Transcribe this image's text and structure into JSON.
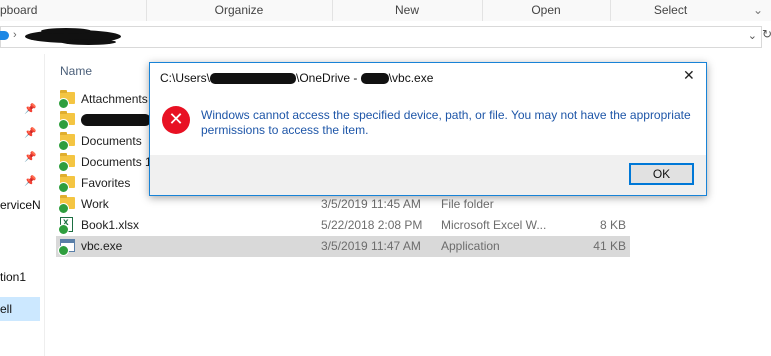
{
  "ribbon": {
    "groups": [
      "pboard",
      "Organize",
      "New",
      "Open",
      "Select"
    ]
  },
  "nav": {
    "items": [
      "erviceN",
      "tion1",
      "ell"
    ]
  },
  "columns": {
    "name": "Name"
  },
  "files": [
    {
      "name": "Attachments",
      "date": "",
      "type": "",
      "size": "",
      "icon": "folder-icon"
    },
    {
      "name": "",
      "date": "",
      "type": "",
      "size": "",
      "icon": "folder-icon"
    },
    {
      "name": "Documents",
      "date": "",
      "type": "",
      "size": "",
      "icon": "folder-icon"
    },
    {
      "name": "Documents 1",
      "date": "",
      "type": "",
      "size": "",
      "icon": "folder-icon"
    },
    {
      "name": "Favorites",
      "date": "",
      "type": "",
      "size": "",
      "icon": "folder-icon"
    },
    {
      "name": "Work",
      "date": "3/5/2019 11:45 AM",
      "type": "File folder",
      "size": "",
      "icon": "folder-icon"
    },
    {
      "name": "Book1.xlsx",
      "date": "5/22/2018 2:08 PM",
      "type": "Microsoft Excel W...",
      "size": "8 KB",
      "icon": "excel-file-icon"
    },
    {
      "name": "vbc.exe",
      "date": "3/5/2019 11:47 AM",
      "type": "Application",
      "size": "41 KB",
      "icon": "exe-file-icon"
    }
  ],
  "dialog": {
    "title_prefix": "C:\\Users\\",
    "title_mid": "\\OneDrive - ",
    "title_suffix": "\\vbc.exe",
    "message": "Windows cannot access the specified device, path, or file. You may not have the appropriate permissions to access the item.",
    "ok_label": "OK",
    "close_glyph": "✕",
    "error_glyph": "✕"
  },
  "colors": {
    "dialog_border": "#1883d7",
    "error_red": "#e81123",
    "message_blue": "#1e56a8",
    "selection_gray": "#d9d9d9",
    "nav_selection": "#cce8ff"
  }
}
